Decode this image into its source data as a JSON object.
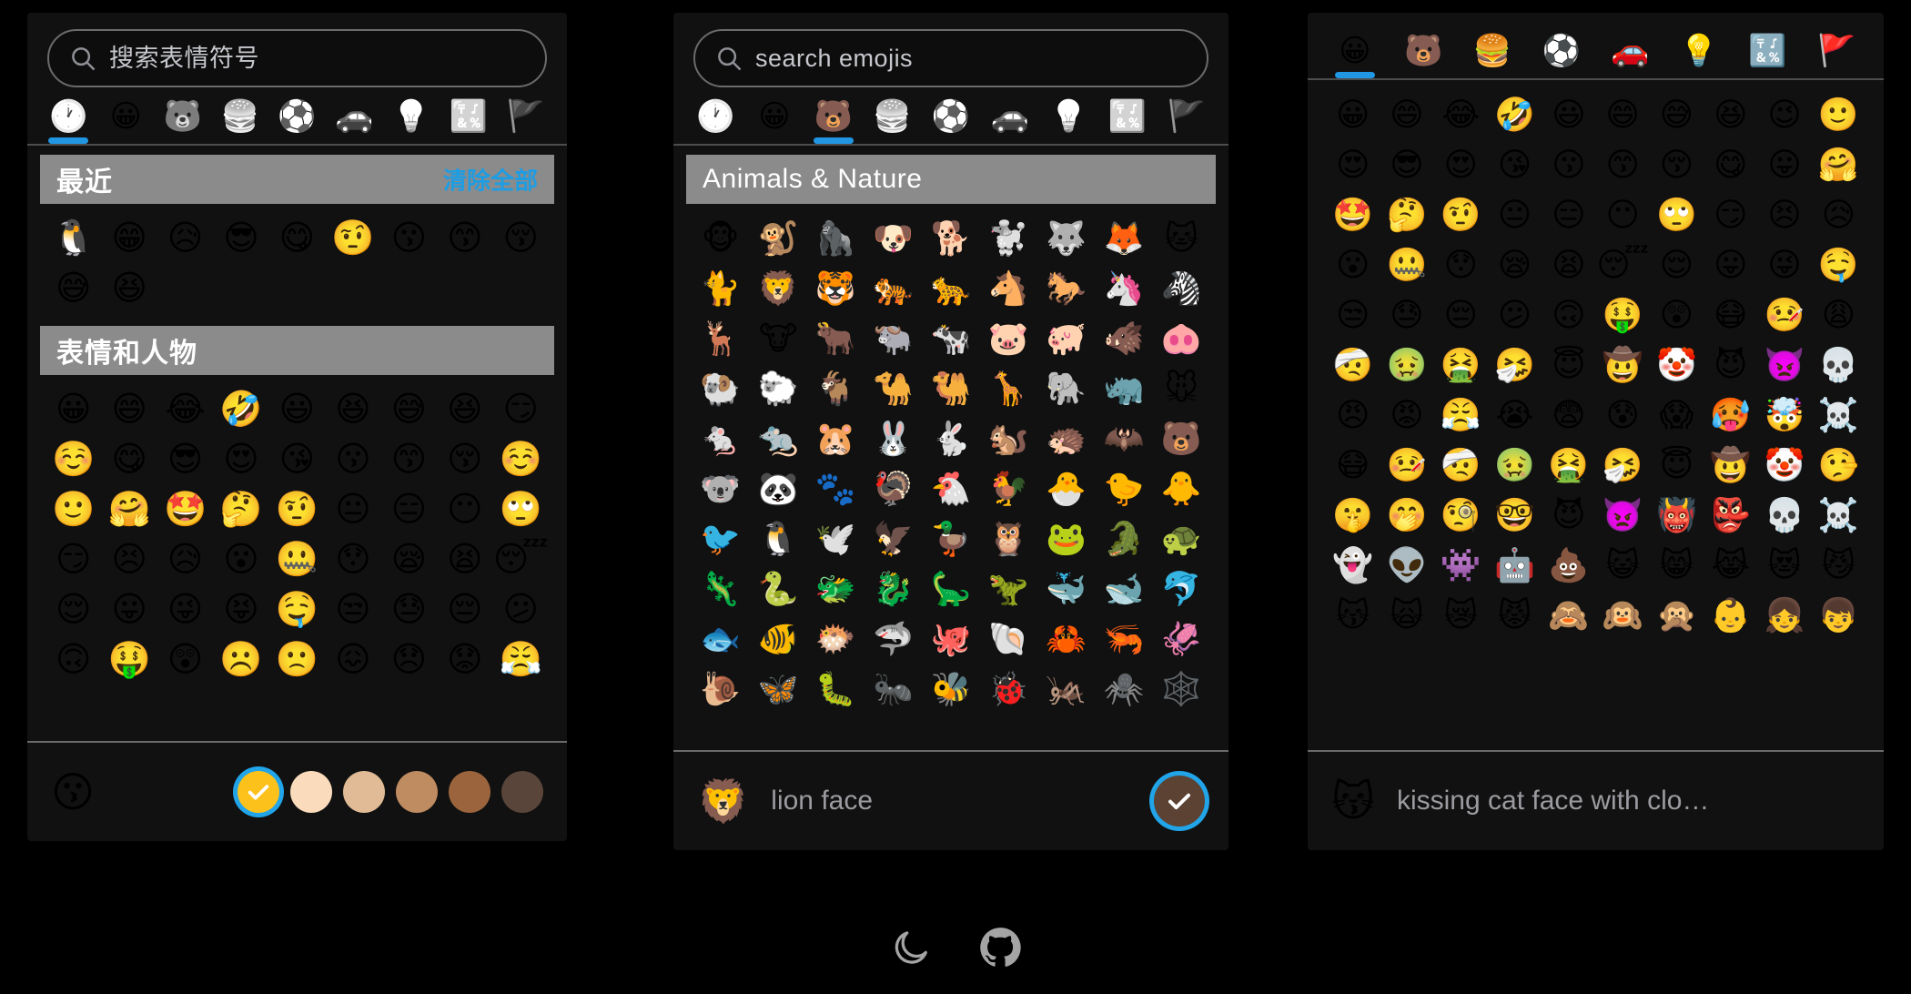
{
  "app": {
    "background_color": "#000000",
    "panel_color": "#111111",
    "accent_color": "#21a4e8",
    "category_header_color": "#8b8b8b"
  },
  "panels": [
    {
      "id": "panel-zh",
      "search": {
        "placeholder": "搜索表情符号",
        "value": "",
        "icon": "search-icon"
      },
      "tabs": [
        {
          "label": "recent",
          "icon": "clock-icon",
          "glyph": "🕐",
          "active": true,
          "colored": false
        },
        {
          "label": "smileys",
          "icon": "smiley-icon",
          "glyph": "😀",
          "active": false,
          "colored": false
        },
        {
          "label": "animals",
          "icon": "bear-icon",
          "glyph": "🐻",
          "active": false,
          "colored": false
        },
        {
          "label": "food",
          "icon": "burger-icon",
          "glyph": "🍔",
          "active": false,
          "colored": false
        },
        {
          "label": "activity",
          "icon": "soccer-icon",
          "glyph": "⚽",
          "active": false,
          "colored": false
        },
        {
          "label": "travel",
          "icon": "car-icon",
          "glyph": "🚗",
          "active": false,
          "colored": false
        },
        {
          "label": "objects",
          "icon": "bulb-icon",
          "glyph": "💡",
          "active": false,
          "colored": false
        },
        {
          "label": "symbols",
          "icon": "symbols-icon",
          "glyph": "🔣",
          "active": false,
          "colored": false
        },
        {
          "label": "flags",
          "icon": "flag-icon",
          "glyph": "🚩",
          "active": false,
          "colored": false
        }
      ],
      "sections": [
        {
          "title": "最近",
          "clear_label": "清除全部",
          "has_clear": true,
          "emojis": [
            "🐧",
            "😁",
            "😥",
            "😎",
            "😋",
            "🤨",
            "😗",
            "😙",
            "😚",
            "😅",
            "😆"
          ]
        },
        {
          "title": "表情和人物",
          "has_clear": false,
          "emojis": [
            "😀",
            "😄",
            "😂",
            "🤣",
            "😃",
            "😆",
            "😅",
            "😆",
            "😏",
            "☺️",
            "😋",
            "😎",
            "😍",
            "😘",
            "😗",
            "😙",
            "😚",
            "☺️",
            "🙂",
            "🤗",
            "🤩",
            "🤔",
            "🤨",
            "😐",
            "😑",
            "😶",
            "🙄",
            "😏",
            "😣",
            "😥",
            "😮",
            "🤐",
            "😯",
            "😪",
            "😫",
            "😴",
            "😌",
            "😛",
            "😜",
            "😝",
            "🤤",
            "😒",
            "😓",
            "😔",
            "😕",
            "🙃",
            "🤑",
            "😲",
            "☹️",
            "🙁",
            "😖",
            "😞",
            "😟",
            "😤"
          ]
        }
      ],
      "footer": {
        "preview_emoji": "😗",
        "preview_name": "",
        "skin_tones": [
          {
            "name": "default",
            "color": "#fcc21b",
            "selected": true
          },
          {
            "name": "light",
            "color": "#fadcbc",
            "selected": false
          },
          {
            "name": "medium-light",
            "color": "#e0bb95",
            "selected": false
          },
          {
            "name": "medium",
            "color": "#bf8b60",
            "selected": false
          },
          {
            "name": "medium-dark",
            "color": "#9b643d",
            "selected": false
          },
          {
            "name": "dark",
            "color": "#594539",
            "selected": false
          }
        ]
      }
    },
    {
      "id": "panel-en",
      "search": {
        "placeholder": "search emojis",
        "value": "",
        "icon": "search-icon"
      },
      "tabs": [
        {
          "label": "recent",
          "icon": "clock-icon",
          "glyph": "🕐",
          "active": false,
          "colored": false
        },
        {
          "label": "smileys",
          "icon": "smiley-icon",
          "glyph": "😀",
          "active": false,
          "colored": false
        },
        {
          "label": "animals",
          "icon": "bear-icon",
          "glyph": "🐻",
          "active": true,
          "colored": true
        },
        {
          "label": "food",
          "icon": "burger-icon",
          "glyph": "🍔",
          "active": false,
          "colored": false
        },
        {
          "label": "activity",
          "icon": "soccer-icon",
          "glyph": "⚽",
          "active": false,
          "colored": false
        },
        {
          "label": "travel",
          "icon": "car-icon",
          "glyph": "🚗",
          "active": false,
          "colored": false
        },
        {
          "label": "objects",
          "icon": "bulb-icon",
          "glyph": "💡",
          "active": false,
          "colored": false
        },
        {
          "label": "symbols",
          "icon": "symbols-icon",
          "glyph": "🔣",
          "active": false,
          "colored": false
        },
        {
          "label": "flags",
          "icon": "flag-icon",
          "glyph": "🚩",
          "active": false,
          "colored": false
        }
      ],
      "sections": [
        {
          "title": "Animals  &  Nature",
          "has_clear": false,
          "emojis": [
            "🐵",
            "🐒",
            "🦍",
            "🐶",
            "🐕",
            "🐩",
            "🐺",
            "🦊",
            "🐱",
            "🐈",
            "🦁",
            "🐯",
            "🐅",
            "🐆",
            "🐴",
            "🐎",
            "🦄",
            "🦓",
            "🦌",
            "🐮",
            "🐂",
            "🐃",
            "🐄",
            "🐷",
            "🐖",
            "🐗",
            "🐽",
            "🐏",
            "🐑",
            "🐐",
            "🐪",
            "🐫",
            "🦒",
            "🐘",
            "🦏",
            "🐭",
            "🐁",
            "🐀",
            "🐹",
            "🐰",
            "🐇",
            "🐿️",
            "🦔",
            "🦇",
            "🐻",
            "🐨",
            "🐼",
            "🐾",
            "🦃",
            "🐔",
            "🐓",
            "🐣",
            "🐤",
            "🐥",
            "🐦",
            "🐧",
            "🕊️",
            "🦅",
            "🦆",
            "🦉",
            "🐸",
            "🐊",
            "🐢",
            "🦎",
            "🐍",
            "🐲",
            "🐉",
            "🦕",
            "🦖",
            "🐳",
            "🐋",
            "🐬",
            "🐟",
            "🐠",
            "🐡",
            "🦈",
            "🐙",
            "🐚",
            "🦀",
            "🦐",
            "🦑",
            "🐌",
            "🦋",
            "🐛",
            "🐜",
            "🐝",
            "🐞",
            "🦗",
            "🕷️",
            "🕸️"
          ]
        }
      ],
      "footer": {
        "preview_emoji": "🦁",
        "preview_name": "lion face",
        "confirm_button": {
          "name": "confirm-skin-tone",
          "color": "#5c4233",
          "selected": true
        }
      }
    },
    {
      "id": "panel-colored",
      "search": null,
      "tabs": [
        {
          "label": "smileys",
          "icon": "smiley-icon",
          "glyph": "😀",
          "active": true,
          "colored": true
        },
        {
          "label": "animals",
          "icon": "bear-icon",
          "glyph": "🐻",
          "active": false,
          "colored": true
        },
        {
          "label": "food",
          "icon": "burger-icon",
          "glyph": "🍔",
          "active": false,
          "colored": true
        },
        {
          "label": "activity",
          "icon": "soccer-icon",
          "glyph": "⚽",
          "active": false,
          "colored": true
        },
        {
          "label": "travel",
          "icon": "car-icon",
          "glyph": "🚗",
          "active": false,
          "colored": true
        },
        {
          "label": "objects",
          "icon": "bulb-icon",
          "glyph": "💡",
          "active": false,
          "colored": true
        },
        {
          "label": "symbols",
          "icon": "symbols-icon",
          "glyph": "🔣",
          "active": false,
          "colored": true
        },
        {
          "label": "flags",
          "icon": "flag-icon",
          "glyph": "🚩",
          "active": false,
          "colored": true
        }
      ],
      "sections": [
        {
          "title": "",
          "has_clear": false,
          "show_header": false,
          "emojis": [
            "😀",
            "😄",
            "😂",
            "🤣",
            "😃",
            "😄",
            "😅",
            "😆",
            "😉",
            "🙂",
            "😍",
            "😎",
            "😍",
            "😘",
            "😗",
            "😙",
            "😚",
            "😋",
            "😛",
            "🤗",
            "🤩",
            "🤔",
            "🤨",
            "😐",
            "😑",
            "😶",
            "🙄",
            "😏",
            "😣",
            "😥",
            "😮",
            "🤐",
            "😯",
            "😪",
            "😫",
            "😴",
            "😌",
            "😛",
            "😜",
            "🤤",
            "😒",
            "😓",
            "😔",
            "😕",
            "🙃",
            "🤑",
            "😲",
            "😷",
            "🤒",
            "😩",
            "🤕",
            "🤢",
            "🤮",
            "🤧",
            "😇",
            "🤠",
            "🤡",
            "😈",
            "👿",
            "💀",
            "😠",
            "😡",
            "😤",
            "😭",
            "😨",
            "😰",
            "😱",
            "🥵",
            "🤯",
            "☠️",
            "😷",
            "🤒",
            "🤕",
            "🤢",
            "🤮",
            "🤧",
            "😇",
            "🤠",
            "🤡",
            "🤥",
            "🤫",
            "🤭",
            "🧐",
            "🤓",
            "😈",
            "👿",
            "👹",
            "👺",
            "💀",
            "☠️",
            "👻",
            "👽",
            "👾",
            "🤖",
            "💩",
            "😺",
            "😸",
            "😹",
            "😻",
            "😼",
            "😽",
            "🙀",
            "😿",
            "😾",
            "🙈",
            "🙉",
            "🙊",
            "👶",
            "👧",
            "👦"
          ]
        }
      ],
      "footer": {
        "preview_emoji": "😽",
        "preview_name": "kissing cat face with clo…"
      }
    }
  ],
  "bottom_toolbar": {
    "items": [
      {
        "name": "dark-mode-icon",
        "label": "dark mode"
      },
      {
        "name": "github-icon",
        "label": "github"
      }
    ]
  }
}
